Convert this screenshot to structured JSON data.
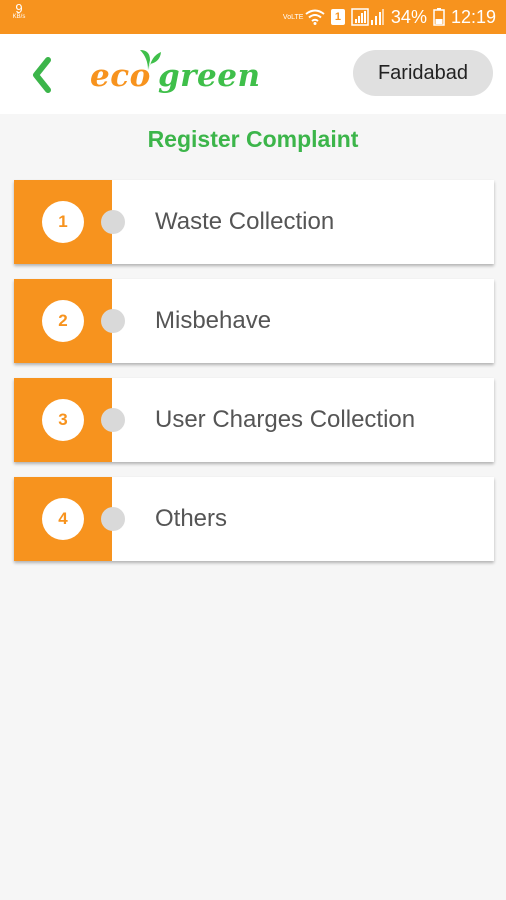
{
  "status_bar": {
    "speed_value": "9",
    "speed_unit": "KB/s",
    "volte": "VoLTE",
    "sim_badge": "1",
    "battery": "34%",
    "time": "12:19"
  },
  "header": {
    "logo_eco": "eco",
    "logo_green": "green",
    "city": "Faridabad"
  },
  "page": {
    "title": "Register Complaint"
  },
  "complaints": [
    {
      "number": "1",
      "label": "Waste Collection"
    },
    {
      "number": "2",
      "label": "Misbehave"
    },
    {
      "number": "3",
      "label": "User Charges Collection"
    },
    {
      "number": "4",
      "label": "Others"
    }
  ],
  "colors": {
    "accent_orange": "#f7931e",
    "brand_green": "#3cb54a"
  }
}
